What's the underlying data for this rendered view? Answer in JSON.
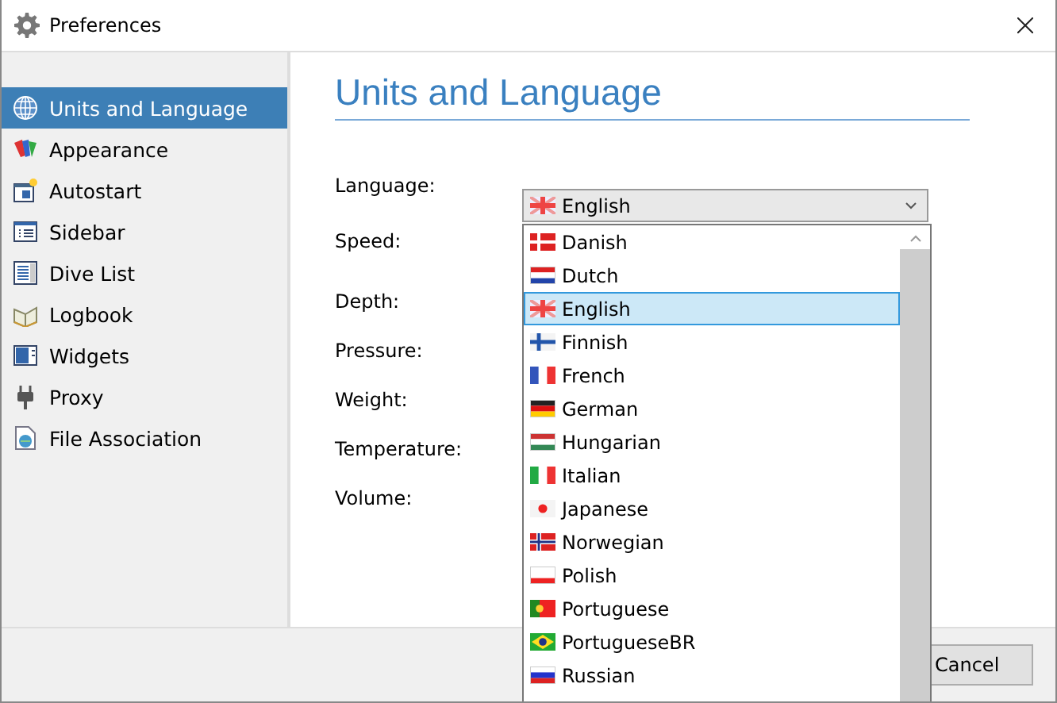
{
  "window": {
    "title": "Preferences"
  },
  "sidebar": {
    "items": [
      {
        "label": "Units and Language",
        "kind": "globe",
        "selected": true
      },
      {
        "label": "Appearance",
        "kind": "palette",
        "selected": false
      },
      {
        "label": "Autostart",
        "kind": "autostart",
        "selected": false
      },
      {
        "label": "Sidebar",
        "kind": "sidebar",
        "selected": false
      },
      {
        "label": "Dive List",
        "kind": "divelist",
        "selected": false
      },
      {
        "label": "Logbook",
        "kind": "book",
        "selected": false
      },
      {
        "label": "Widgets",
        "kind": "widgets",
        "selected": false
      },
      {
        "label": "Proxy",
        "kind": "plug",
        "selected": false
      },
      {
        "label": "File Association",
        "kind": "file",
        "selected": false
      }
    ]
  },
  "page": {
    "title": "Units and Language",
    "fields": [
      "Language:",
      "Speed:",
      "Depth:",
      "Pressure:",
      "Weight:",
      "Temperature:",
      "Volume:"
    ],
    "language_combo": {
      "value": "English",
      "kind": "uk",
      "expanded": true
    },
    "dropdown": [
      {
        "label": "Danish",
        "kind": "dk",
        "selected": false
      },
      {
        "label": "Dutch",
        "kind": "nl",
        "selected": false
      },
      {
        "label": "English",
        "kind": "uk",
        "selected": true
      },
      {
        "label": "Finnish",
        "kind": "fi",
        "selected": false
      },
      {
        "label": "French",
        "kind": "fr",
        "selected": false
      },
      {
        "label": "German",
        "kind": "de",
        "selected": false
      },
      {
        "label": "Hungarian",
        "kind": "hu",
        "selected": false
      },
      {
        "label": "Italian",
        "kind": "it",
        "selected": false
      },
      {
        "label": "Japanese",
        "kind": "jp",
        "selected": false
      },
      {
        "label": "Norwegian",
        "kind": "no",
        "selected": false
      },
      {
        "label": "Polish",
        "kind": "pl",
        "selected": false
      },
      {
        "label": "Portuguese",
        "kind": "pt",
        "selected": false
      },
      {
        "label": "PortugueseBR",
        "kind": "br",
        "selected": false
      },
      {
        "label": "Russian",
        "kind": "ru",
        "selected": false
      }
    ]
  },
  "buttons": [
    "Cancel"
  ]
}
